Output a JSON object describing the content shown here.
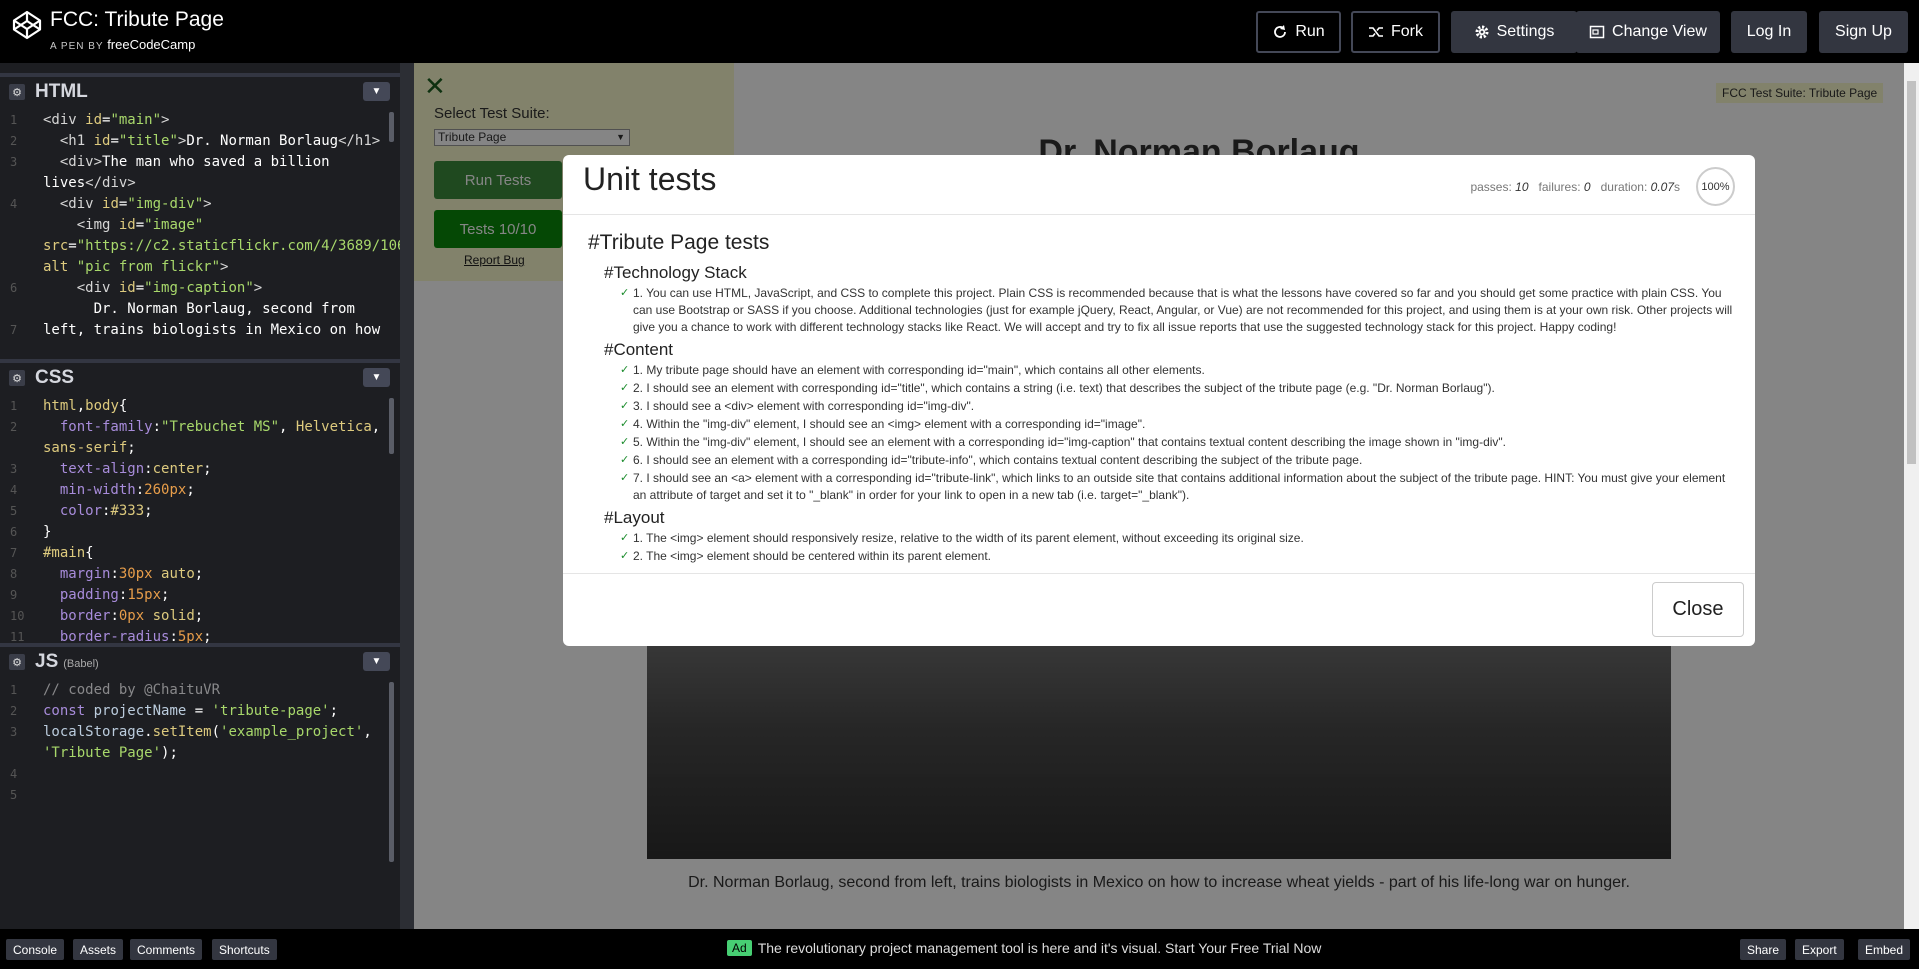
{
  "header": {
    "title": "FCC: Tribute Page",
    "byline_prefix": "A PEN BY",
    "author": "freeCodeCamp",
    "buttons": {
      "run": "Run",
      "fork": "Fork",
      "settings": "Settings",
      "change_view": "Change View",
      "login": "Log In",
      "signup": "Sign Up"
    }
  },
  "html_pane": {
    "label": "HTML"
  },
  "css_pane": {
    "label": "CSS"
  },
  "js_pane": {
    "label": "JS",
    "sublabel": "(Babel)"
  },
  "preview": {
    "suite_label": "Select Test Suite:",
    "suite_selected": "Tribute Page",
    "run_tests": "Run Tests",
    "tests_count": "Tests 10/10",
    "report_bug": "Report Bug",
    "badge": "FCC Test Suite: Tribute Page",
    "page_title": "Dr. Norman Borlaug",
    "caption": "Dr. Norman Borlaug, second from left, trains biologists in Mexico on how to increase wheat yields - part of his life-long war on hunger."
  },
  "modal": {
    "title": "Unit tests",
    "passes_label": "passes:",
    "passes": "10",
    "failures_label": "failures:",
    "failures": "0",
    "duration_label": "duration:",
    "duration": "0.07",
    "duration_unit": "s",
    "percent": "100%",
    "suite": "#Tribute Page tests",
    "groups": [
      {
        "name": "#Technology Stack",
        "tests": [
          "1. You can use HTML, JavaScript, and CSS to complete this project. Plain CSS is recommended because that is what the lessons have covered so far and you should get some practice with plain CSS. You can use Bootstrap or SASS if you choose. Additional technologies (just for example jQuery, React, Angular, or Vue) are not recommended for this project, and using them is at your own risk. Other projects will give you a chance to work with different technology stacks like React. We will accept and try to fix all issue reports that use the suggested technology stack for this project. Happy coding!"
        ]
      },
      {
        "name": "#Content",
        "tests": [
          "1. My tribute page should have an element with corresponding id=\"main\", which contains all other elements.",
          "2. I should see an element with corresponding id=\"title\", which contains a string (i.e. text) that describes the subject of the tribute page (e.g. \"Dr. Norman Borlaug\").",
          "3. I should see a <div> element with corresponding id=\"img-div\".",
          "4. Within the \"img-div\" element, I should see an <img> element with a corresponding id=\"image\".",
          "5. Within the \"img-div\" element, I should see an element with a corresponding id=\"img-caption\" that contains textual content describing the image shown in \"img-div\".",
          "6. I should see an element with a corresponding id=\"tribute-info\", which contains textual content describing the subject of the tribute page.",
          "7. I should see an <a> element with a corresponding id=\"tribute-link\", which links to an outside site that contains additional information about the subject of the tribute page. HINT: You must give your element an attribute of target and set it to \"_blank\" in order for your link to open in a new tab (i.e. target=\"_blank\")."
        ]
      },
      {
        "name": "#Layout",
        "tests": [
          "1. The <img> element should responsively resize, relative to the width of its parent element, without exceeding its original size.",
          "2. The <img> element should be centered within its parent element."
        ]
      }
    ],
    "close": "Close"
  },
  "footer": {
    "buttons": {
      "console": "Console",
      "assets": "Assets",
      "comments": "Comments",
      "shortcuts": "Shortcuts",
      "share": "Share",
      "export": "Export",
      "embed": "Embed"
    },
    "ad_badge": "Ad",
    "ad_text": "The revolutionary project management tool is here and it's visual. Start Your Free Trial Now"
  }
}
